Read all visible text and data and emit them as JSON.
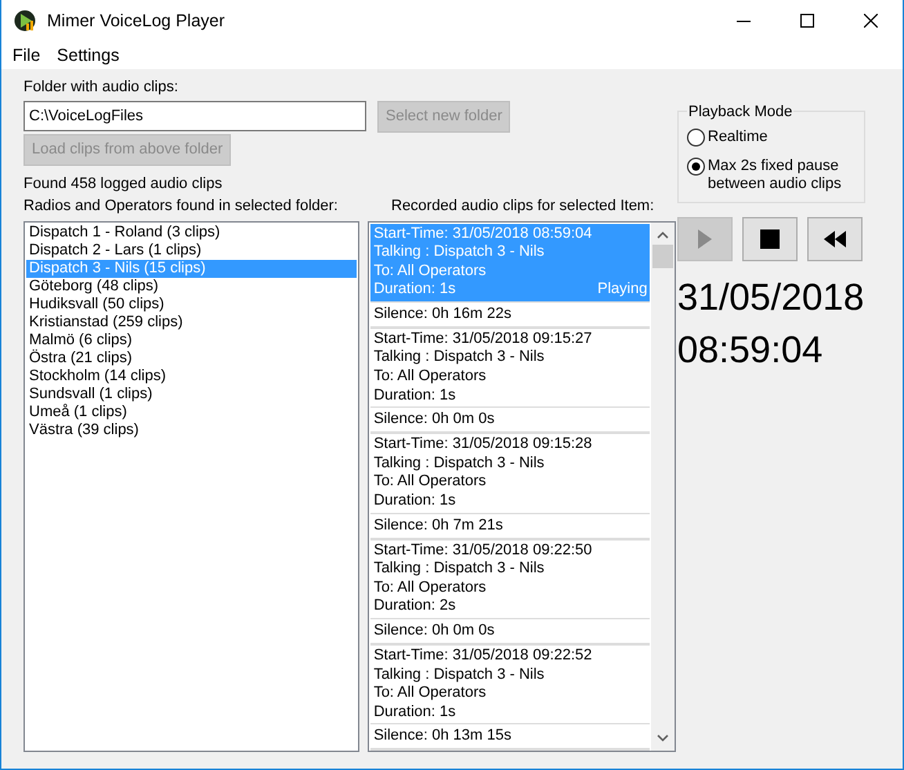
{
  "window": {
    "title": "Mimer VoiceLog Player"
  },
  "menu": [
    "File",
    "Settings"
  ],
  "folder": {
    "label": "Folder with audio clips:",
    "value": "C:\\VoiceLogFiles",
    "select_button": {
      "label": "Select new folder",
      "disabled": true
    },
    "load_button": {
      "label": "Load clips from above folder",
      "disabled": true
    }
  },
  "found_text": "Found 458 logged audio clips",
  "radios_label": "Radios and Operators found in selected folder:",
  "radios": [
    {
      "label": "Dispatch 1 - Roland (3 clips)",
      "selected": false
    },
    {
      "label": "Dispatch 2 - Lars (1 clips)",
      "selected": false
    },
    {
      "label": "Dispatch 3 - Nils (15 clips)",
      "selected": true
    },
    {
      "label": "Göteborg (48 clips)",
      "selected": false
    },
    {
      "label": "Hudiksvall (50 clips)",
      "selected": false
    },
    {
      "label": "Kristianstad (259 clips)",
      "selected": false
    },
    {
      "label": "Malmö (6 clips)",
      "selected": false
    },
    {
      "label": "Östra (21 clips)",
      "selected": false
    },
    {
      "label": "Stockholm (14 clips)",
      "selected": false
    },
    {
      "label": "Sundsvall (1 clips)",
      "selected": false
    },
    {
      "label": "Umeå (1 clips)",
      "selected": false
    },
    {
      "label": "Västra (39 clips)",
      "selected": false
    }
  ],
  "clips_label": "Recorded audio clips for selected Item:",
  "clips": [
    {
      "start": "Start-Time: 31/05/2018 08:59:04",
      "talking": "Talking : Dispatch 3 - Nils",
      "to": "To: All Operators",
      "duration": "Duration: 1s",
      "status": "Playing",
      "selected": true,
      "silence": "Silence: 0h 16m 22s"
    },
    {
      "start": "Start-Time: 31/05/2018 09:15:27",
      "talking": "Talking : Dispatch 3 - Nils",
      "to": "To: All Operators",
      "duration": "Duration: 1s",
      "selected": false,
      "silence": "Silence: 0h 0m 0s"
    },
    {
      "start": "Start-Time: 31/05/2018 09:15:28",
      "talking": "Talking : Dispatch 3 - Nils",
      "to": "To: All Operators",
      "duration": "Duration: 1s",
      "selected": false,
      "silence": "Silence: 0h 7m 21s"
    },
    {
      "start": "Start-Time: 31/05/2018 09:22:50",
      "talking": "Talking : Dispatch 3 - Nils",
      "to": "To: All Operators",
      "duration": "Duration: 2s",
      "selected": false,
      "silence": "Silence: 0h 0m 0s"
    },
    {
      "start": "Start-Time: 31/05/2018 09:22:52",
      "talking": "Talking : Dispatch 3 - Nils",
      "to": "To: All Operators",
      "duration": "Duration: 1s",
      "selected": false,
      "silence": "Silence: 0h 13m 15s"
    }
  ],
  "playback_mode": {
    "title": "Playback Mode",
    "options": [
      {
        "label": "Realtime",
        "selected": false
      },
      {
        "label": "Max 2s fixed pause between audio clips",
        "selected": true
      }
    ]
  },
  "transport": [
    {
      "kind": "play",
      "disabled": true
    },
    {
      "kind": "stop",
      "disabled": false
    },
    {
      "kind": "rewind",
      "disabled": false
    }
  ],
  "date": "31/05/2018",
  "time": "08:59:04"
}
